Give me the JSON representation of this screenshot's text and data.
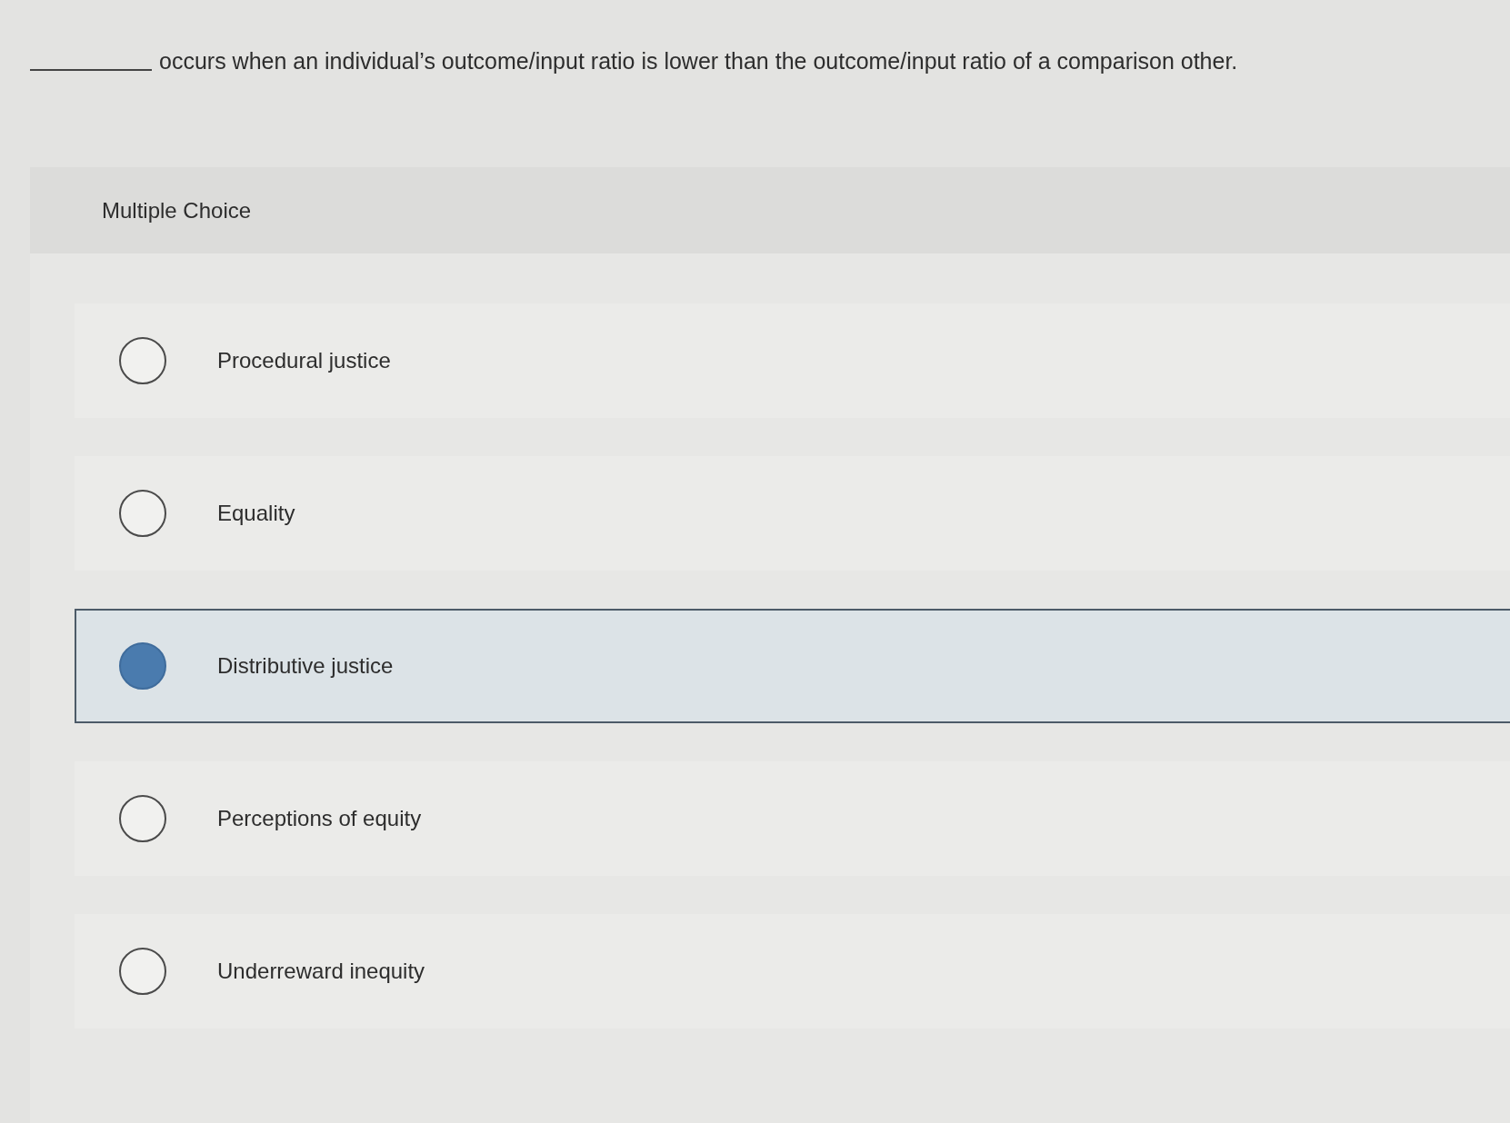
{
  "question": {
    "text": "occurs when an individual’s outcome/input ratio is lower than the outcome/input ratio of a comparison other."
  },
  "answer_panel": {
    "label": "Multiple Choice",
    "options": [
      {
        "label": "Procedural justice",
        "selected": false
      },
      {
        "label": "Equality",
        "selected": false
      },
      {
        "label": "Distributive justice",
        "selected": true
      },
      {
        "label": "Perceptions of equity",
        "selected": false
      },
      {
        "label": "Underreward inequity",
        "selected": false
      }
    ]
  }
}
